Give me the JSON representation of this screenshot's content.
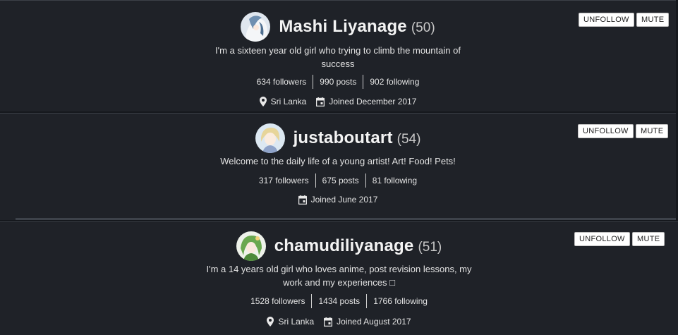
{
  "buttons": {
    "unfollow": "UNFOLLOW",
    "mute": "MUTE"
  },
  "users": [
    {
      "username": "Mashi Liyanage",
      "reputation": "(50)",
      "bio_line1": "I'm a sixteen year old girl who trying to climb the mountain of",
      "bio_line2": "success",
      "followers": "634 followers",
      "posts": "990 posts",
      "following": "902 following",
      "location": "Sri Lanka",
      "joined": "Joined December 2017"
    },
    {
      "username": "justaboutart",
      "reputation": "(54)",
      "bio_line1": "Welcome to the daily life of a young artist! Art! Food! Pets!",
      "followers": "317 followers",
      "posts": "675 posts",
      "following": "81 following",
      "joined": "Joined June 2017"
    },
    {
      "username": "chamudiliyanage",
      "reputation": "(51)",
      "bio_line1": "I'm a 14 years old girl who loves anime, post revision lessons, my",
      "bio_line2": "work and my experiences □",
      "followers": "1528 followers",
      "posts": "1434 posts",
      "following": "1766 following",
      "location": "Sri Lanka",
      "joined": "Joined August 2017"
    }
  ]
}
